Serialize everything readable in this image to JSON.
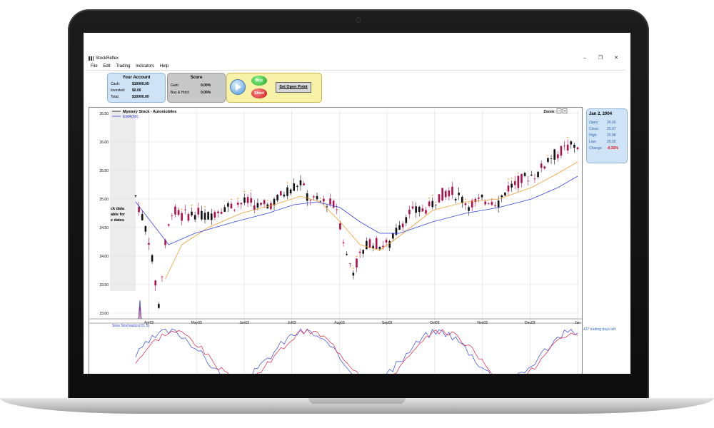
{
  "window": {
    "title": "StockReflex",
    "minimize": "–",
    "maximize": "❐",
    "close": "✕"
  },
  "menu": [
    "File",
    "Edit",
    "Trading",
    "Indicators",
    "Help"
  ],
  "account": {
    "title": "Your Account",
    "cash_label": "Cash:",
    "cash": "$10000.00",
    "invested_label": "Invested:",
    "invested": "$0.00",
    "total_label": "Total:",
    "total": "$10000.00"
  },
  "score": {
    "title": "Score",
    "gain_label": "Gain:",
    "gain": "0.00%",
    "bh_label": "Buy & Hold:",
    "bh": "0.00%"
  },
  "controls": {
    "buy": "Buy",
    "short": "Short",
    "open_point": "Set Open Point"
  },
  "quote": {
    "date": "Jan 2, 2004",
    "open_label": "Open:",
    "open": "26.00",
    "close_label": "Close:",
    "close": "25.97",
    "high_label": "High:",
    "high": "25.98",
    "low_label": "Low:",
    "low": "26.00",
    "change_label": "Change:",
    "change": "-0.31%"
  },
  "chart": {
    "legend_main": "Mystery Stock - Automobiles",
    "legend_ema": "EMA(50)",
    "zoom_label": "Zoom:",
    "zoom_out": "−",
    "zoom_in": "+",
    "no_data_text": [
      "ck data",
      "able for",
      "e dates"
    ],
    "stoch_label": "Slow Stochastics(15, 5)",
    "trading_days_left": "437 trading days left"
  },
  "colors": {
    "up": "#111111",
    "down": "#b0104a",
    "ema50": "#3344dd",
    "ema_short": "#f0a030",
    "marker": "#f0a030"
  },
  "chart_data": {
    "type": "candlestick",
    "title": "Mystery Stock - Automobiles",
    "y_ticks": [
      "26.50",
      "26.00",
      "25.50",
      "25.00",
      "24.50",
      "24.00",
      "23.50",
      "23.00"
    ],
    "ylim": [
      22.9,
      26.55
    ],
    "x_ticks": [
      "Apr03",
      "May03",
      "Jun03",
      "Jul03",
      "Aug03",
      "Sep03",
      "Oct03",
      "Nov03",
      "Dec03",
      "Jan"
    ],
    "price_path": [
      [
        0,
        25.05
      ],
      [
        4,
        24.3
      ],
      [
        7,
        23.15
      ],
      [
        9,
        24.2
      ],
      [
        11,
        24.8
      ],
      [
        14,
        24.7
      ],
      [
        18,
        24.75
      ],
      [
        22,
        24.7
      ],
      [
        26,
        24.85
      ],
      [
        30,
        24.9
      ],
      [
        34,
        24.95
      ],
      [
        38,
        24.85
      ],
      [
        42,
        24.95
      ],
      [
        46,
        25.15
      ],
      [
        50,
        25.3
      ],
      [
        52,
        25.05
      ],
      [
        55,
        24.95
      ],
      [
        58,
        24.95
      ],
      [
        61,
        24.85
      ],
      [
        64,
        24.0
      ],
      [
        66,
        23.75
      ],
      [
        68,
        24.0
      ],
      [
        71,
        24.25
      ],
      [
        74,
        24.2
      ],
      [
        77,
        24.2
      ],
      [
        80,
        24.55
      ],
      [
        83,
        24.75
      ],
      [
        86,
        24.8
      ],
      [
        89,
        24.85
      ],
      [
        92,
        25.05
      ],
      [
        95,
        25.15
      ],
      [
        98,
        25.05
      ],
      [
        101,
        24.9
      ],
      [
        104,
        24.95
      ],
      [
        107,
        25.0
      ],
      [
        110,
        24.95
      ],
      [
        113,
        25.2
      ],
      [
        116,
        25.3
      ],
      [
        119,
        25.4
      ],
      [
        122,
        25.45
      ],
      [
        125,
        25.7
      ],
      [
        128,
        25.8
      ],
      [
        131,
        25.9
      ],
      [
        134,
        25.95
      ]
    ],
    "ema50": [
      [
        0,
        24.95
      ],
      [
        6,
        24.5
      ],
      [
        10,
        24.2
      ],
      [
        18,
        24.4
      ],
      [
        30,
        24.6
      ],
      [
        40,
        24.75
      ],
      [
        48,
        24.9
      ],
      [
        55,
        24.95
      ],
      [
        62,
        24.85
      ],
      [
        68,
        24.6
      ],
      [
        74,
        24.4
      ],
      [
        80,
        24.4
      ],
      [
        90,
        24.6
      ],
      [
        100,
        24.75
      ],
      [
        110,
        24.85
      ],
      [
        120,
        25.0
      ],
      [
        128,
        25.2
      ],
      [
        134,
        25.4
      ]
    ],
    "ema_short": [
      [
        9,
        23.6
      ],
      [
        14,
        24.2
      ],
      [
        22,
        24.5
      ],
      [
        32,
        24.75
      ],
      [
        42,
        24.9
      ],
      [
        50,
        25.05
      ],
      [
        56,
        24.95
      ],
      [
        62,
        24.6
      ],
      [
        68,
        24.2
      ],
      [
        74,
        24.1
      ],
      [
        80,
        24.35
      ],
      [
        90,
        24.8
      ],
      [
        100,
        24.95
      ],
      [
        110,
        25.0
      ],
      [
        120,
        25.2
      ],
      [
        128,
        25.45
      ],
      [
        134,
        25.65
      ]
    ]
  }
}
